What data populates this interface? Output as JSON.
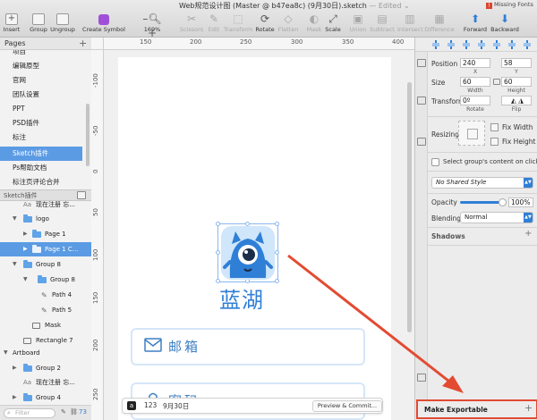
{
  "window": {
    "title": "Web规范设计图 (Master @ b47ea8c) (9月30日).sketch",
    "edited": " — Edited ⌄",
    "missing_fonts": "Missing Fonts"
  },
  "toolbar": {
    "insert": "Insert",
    "group": "Group",
    "ungroup": "Ungroup",
    "create_symbol": "Create Symbol",
    "zoom": "169%",
    "scissors": "Scissors",
    "edit": "Edit",
    "transform": "Transform",
    "rotate": "Rotate",
    "flatten": "Flatten",
    "mask": "Mask",
    "scale": "Scale",
    "union": "Union",
    "subtract": "Subtract",
    "intersect": "Intersect",
    "difference": "Difference",
    "forward": "Forward",
    "backward": "Backward"
  },
  "pages": {
    "header": "Pages",
    "items": [
      "项目",
      "编辑原型",
      "官网",
      "团队设置",
      "PPT",
      "PSD插件",
      "标注",
      "Sketch插件",
      "Ps帮助文档",
      "标注页评论合并"
    ],
    "selected_index": 7
  },
  "section_bar": {
    "label": "Sketch插件"
  },
  "layers": {
    "items": [
      {
        "name": "现在注册 忘...",
        "type": "text"
      },
      {
        "name": "logo",
        "type": "group"
      },
      {
        "name": "Page 1",
        "type": "group"
      },
      {
        "name": "Page 1 C...",
        "type": "group"
      },
      {
        "name": "Group 8",
        "type": "group"
      },
      {
        "name": "Group 8",
        "type": "group"
      },
      {
        "name": "Path 4",
        "type": "path"
      },
      {
        "name": "Path 5",
        "type": "path"
      },
      {
        "name": "Mask",
        "type": "shape"
      },
      {
        "name": "Rectangle 7",
        "type": "shape"
      },
      {
        "name": "Artboard",
        "type": "artboard"
      },
      {
        "name": "Group 2",
        "type": "group"
      },
      {
        "name": "现在注册 忘...",
        "type": "text"
      },
      {
        "name": "Group 4",
        "type": "group"
      }
    ],
    "filter_placeholder": "Filter",
    "count": "73"
  },
  "rulers": {
    "top": [
      "150",
      "200",
      "250",
      "300",
      "350",
      "400"
    ],
    "left": [
      "-100",
      "-50",
      "0",
      "50",
      "100",
      "150",
      "200",
      "250"
    ]
  },
  "artboard": {
    "brand_text": "蓝湖",
    "email_placeholder": "邮箱",
    "password_placeholder": "密码"
  },
  "canvas_bar": {
    "number": "123",
    "date": "9月30日",
    "preview_commit": "Preview & Commit..."
  },
  "inspector": {
    "position_label": "Position",
    "x": "240",
    "y": "58",
    "x_label": "X",
    "y_label": "Y",
    "size_label": "Size",
    "width": "60",
    "height": "60",
    "width_label": "Width",
    "height_label": "Height",
    "transform_label": "Transform",
    "rotate_value": "0º",
    "rotate_label": "Rotate",
    "flip_label": "Flip",
    "resizing_label": "Resizing",
    "fix_width": "Fix Width",
    "fix_height": "Fix Height",
    "select_group_content": "Select group's content on click",
    "shared_style": "No Shared Style",
    "opacity_label": "Opacity",
    "opacity_value": "100%",
    "blending_label": "Blending",
    "blending_value": "Normal",
    "shadows_label": "Shadows",
    "make_exportable": "Make Exportable"
  },
  "colors": {
    "accent": "#2f7fd6",
    "selection": "#5b9be4",
    "annotation": "#e24b32",
    "field_text": "#3e7ec3"
  }
}
